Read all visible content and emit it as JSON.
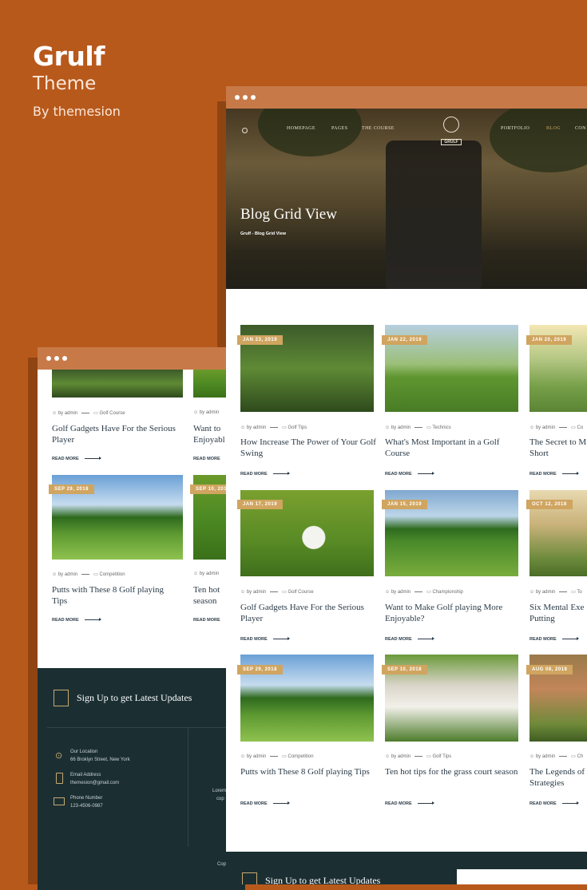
{
  "brand": {
    "name": "Grulf",
    "subtitle": "Theme",
    "byline": "By themesion"
  },
  "front": {
    "nav_left": [
      "HOMEPAGE",
      "PAGES",
      "THE COURSE"
    ],
    "nav_right": [
      "PORTFOLIO",
      "BLOG",
      "CON"
    ],
    "logo_text": "GRULF",
    "hero_title": "Blog Grid View",
    "breadcrumb": "Grulf - Blog Grid View",
    "posts": [
      {
        "date": "JAN 23, 2019",
        "author": "by admin",
        "category": "Golf Tips",
        "title": "How Increase The Power of Your Golf Swing",
        "more": "READ MORE"
      },
      {
        "date": "JAN 22, 2019",
        "author": "by admin",
        "category": "Technics",
        "title": "What's Most Important in a Golf Course",
        "more": "READ MORE"
      },
      {
        "date": "JAN 20, 2019",
        "author": "by admin",
        "category": "Co",
        "title": "The Secret to M Short",
        "more": "READ MORE"
      },
      {
        "date": "JAN 17, 2019",
        "author": "by admin",
        "category": "Golf Course",
        "title": "Golf Gadgets Have For the Serious Player",
        "more": "READ MORE"
      },
      {
        "date": "JAN 15, 2019",
        "author": "by admin",
        "category": "Championship",
        "title": "Want to Make Golf playing More Enjoyable?",
        "more": "READ MORE"
      },
      {
        "date": "OCT 12, 2018",
        "author": "by admin",
        "category": "To",
        "title": "Six Mental Exe Putting",
        "more": "READ MORE"
      },
      {
        "date": "SEP 29, 2018",
        "author": "by admin",
        "category": "Competition",
        "title": "Putts with These 8 Golf playing Tips",
        "more": "READ MORE"
      },
      {
        "date": "SEP 10, 2018",
        "author": "by admin",
        "category": "Golf Tips",
        "title": "Ten hot tips for the grass court season",
        "more": "READ MORE"
      },
      {
        "date": "AUG 08, 2018",
        "author": "by admin",
        "category": "Ch",
        "title": "The Legends of Strategies",
        "more": "READ MORE"
      }
    ],
    "footer_signup": "Sign Up to get Latest Updates"
  },
  "back": {
    "posts": [
      {
        "date": "",
        "author": "by admin",
        "category": "Golf Course",
        "title": "Golf Gadgets Have For the Serious Player",
        "more": "READ MORE"
      },
      {
        "date": "",
        "author": "by admin",
        "category": "",
        "title": "Want to Enjoyabl",
        "more": "READ MORE"
      },
      {
        "date": "SEP 29, 2018",
        "author": "by admin",
        "category": "Competition",
        "title": "Putts with These 8 Golf playing Tips",
        "more": "READ MORE"
      },
      {
        "date": "SEP 10, 201",
        "author": "by admin",
        "category": "",
        "title": "Ten hot season",
        "more": "READ MORE"
      }
    ],
    "footer": {
      "signup": "Sign Up to get Latest Updates",
      "location_label": "Our Location",
      "location": "66 Broklyn Street, New York",
      "email_label": "Email Address",
      "email": "themesion@gmail.com",
      "phone_label": "Phone Number",
      "phone": "123-4506-0987",
      "lorem": "Lorem",
      "cop": "cop",
      "copy": "Cop"
    }
  },
  "colors": {
    "background": "#b8591c",
    "window_bar": "#c77a48",
    "date_tag": "#d0a560",
    "footer": "#1b2f33"
  }
}
